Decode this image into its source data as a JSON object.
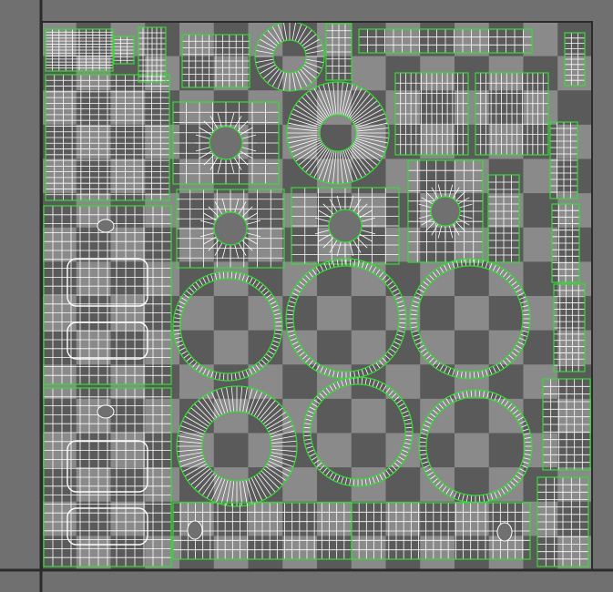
{
  "editor": {
    "view": "uv-editor-viewport",
    "background_color": "#707070",
    "checker_dark": "#5a5a5a",
    "checker_light": "#8a8a8a",
    "axis_color": "#2b2b2b",
    "seam_color": "#2fe02f",
    "wire_color": "#ffffff",
    "checker_tiles": 16
  }
}
